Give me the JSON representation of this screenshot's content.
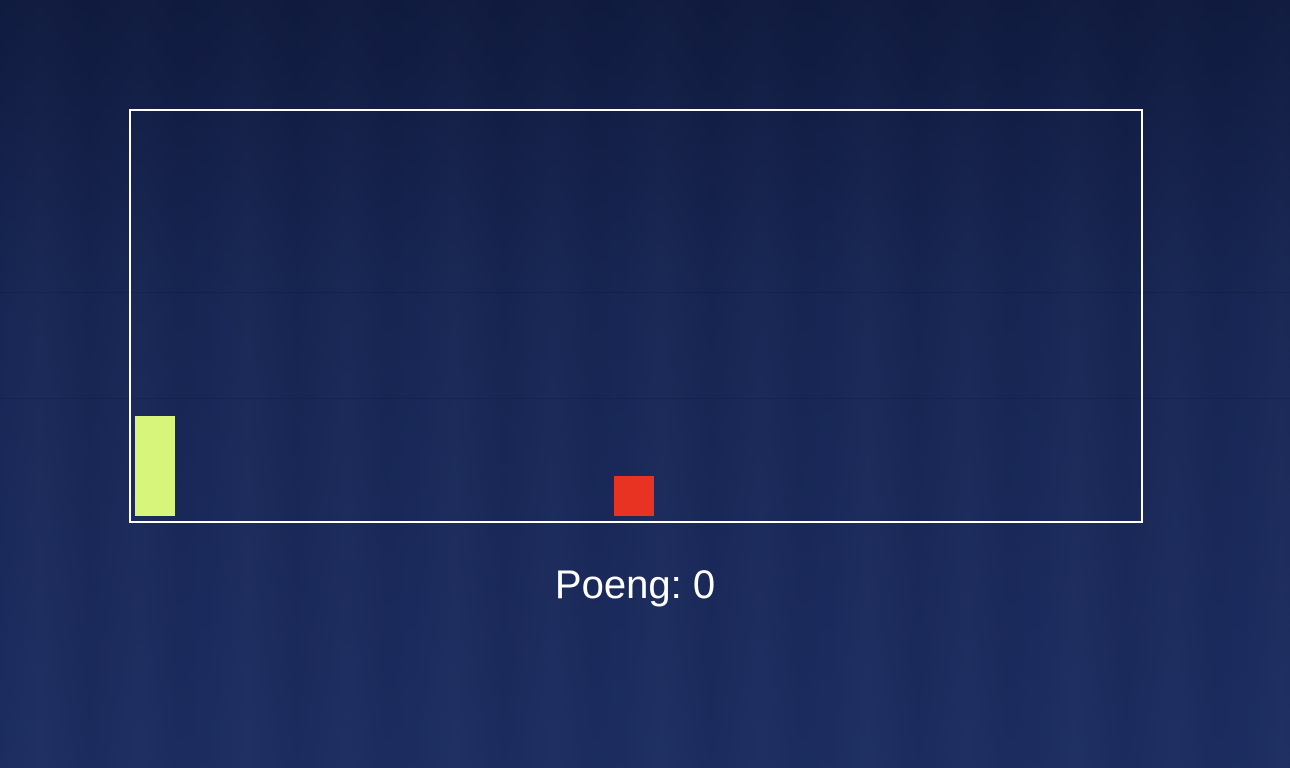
{
  "colors": {
    "background": "#1a2a5c",
    "board_border": "#ffffff",
    "player": "#d6f57a",
    "obstacle": "#e83323",
    "score_text": "#ffffff"
  },
  "score": {
    "label": "Poeng: ",
    "value": "0"
  }
}
